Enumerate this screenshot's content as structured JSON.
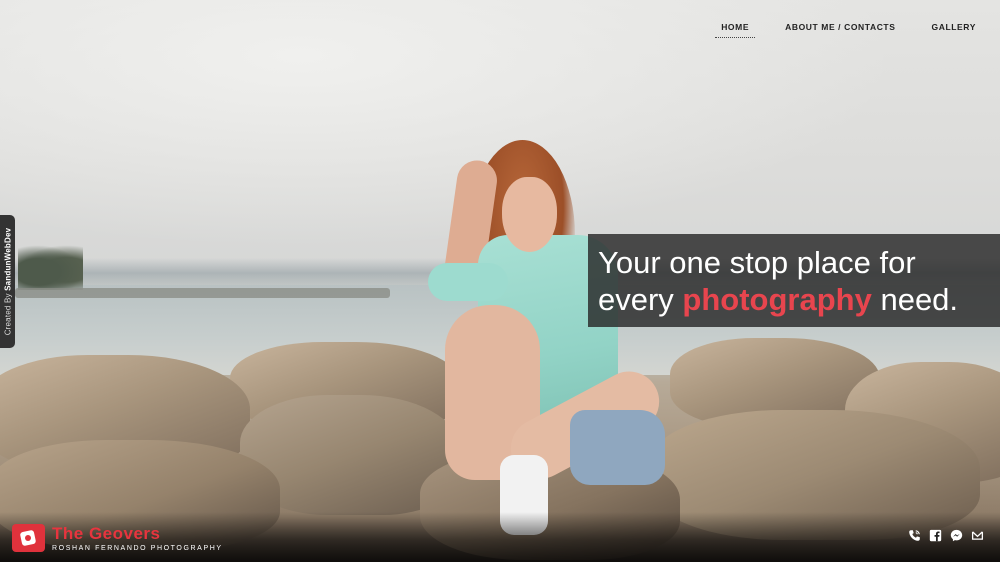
{
  "nav": {
    "items": [
      {
        "label": "HOME",
        "active": true
      },
      {
        "label": "ABOUT ME / CONTACTS",
        "active": false
      },
      {
        "label": "GALLERY",
        "active": false
      }
    ]
  },
  "credit": {
    "prefix": "Created By ",
    "author": "SandunWebDev"
  },
  "hero": {
    "line1": "Your one stop place for",
    "line2_before": "every ",
    "line2_highlight": "photography",
    "line2_after": " need."
  },
  "brand": {
    "name": "The Geovers",
    "tagline": "ROSHAN FERNANDO PHOTOGRAPHY",
    "logo_icon": "camera-logo-icon"
  },
  "social": [
    {
      "icon": "phone-icon"
    },
    {
      "icon": "facebook-icon"
    },
    {
      "icon": "messenger-icon"
    },
    {
      "icon": "mail-icon"
    }
  ],
  "colors": {
    "accent": "#e8454e",
    "overlay": "#282828"
  }
}
